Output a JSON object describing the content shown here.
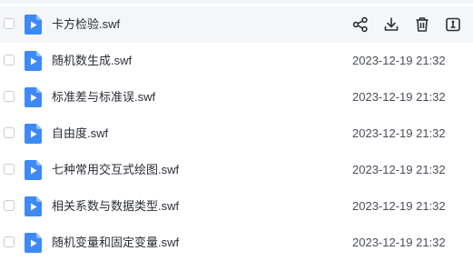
{
  "files": [
    {
      "name": "卡方检验.swf",
      "date": "",
      "hovered": true,
      "actions": [
        "share-icon",
        "download-icon",
        "delete-icon",
        "more-icon"
      ]
    },
    {
      "name": "随机数生成.swf",
      "date": "2023-12-19 21:32"
    },
    {
      "name": "标准差与标准误.swf",
      "date": "2023-12-19 21:32"
    },
    {
      "name": "自由度.swf",
      "date": "2023-12-19 21:32"
    },
    {
      "name": "七种常用交互式绘图.swf",
      "date": "2023-12-19 21:32"
    },
    {
      "name": "相关系数与数据类型.swf",
      "date": "2023-12-19 21:32"
    },
    {
      "name": "随机变量和固定变量.swf",
      "date": "2023-12-19 21:32"
    }
  ],
  "colors": {
    "file_icon": "#3d8af7",
    "hover_bg": "#f5f6f8"
  }
}
